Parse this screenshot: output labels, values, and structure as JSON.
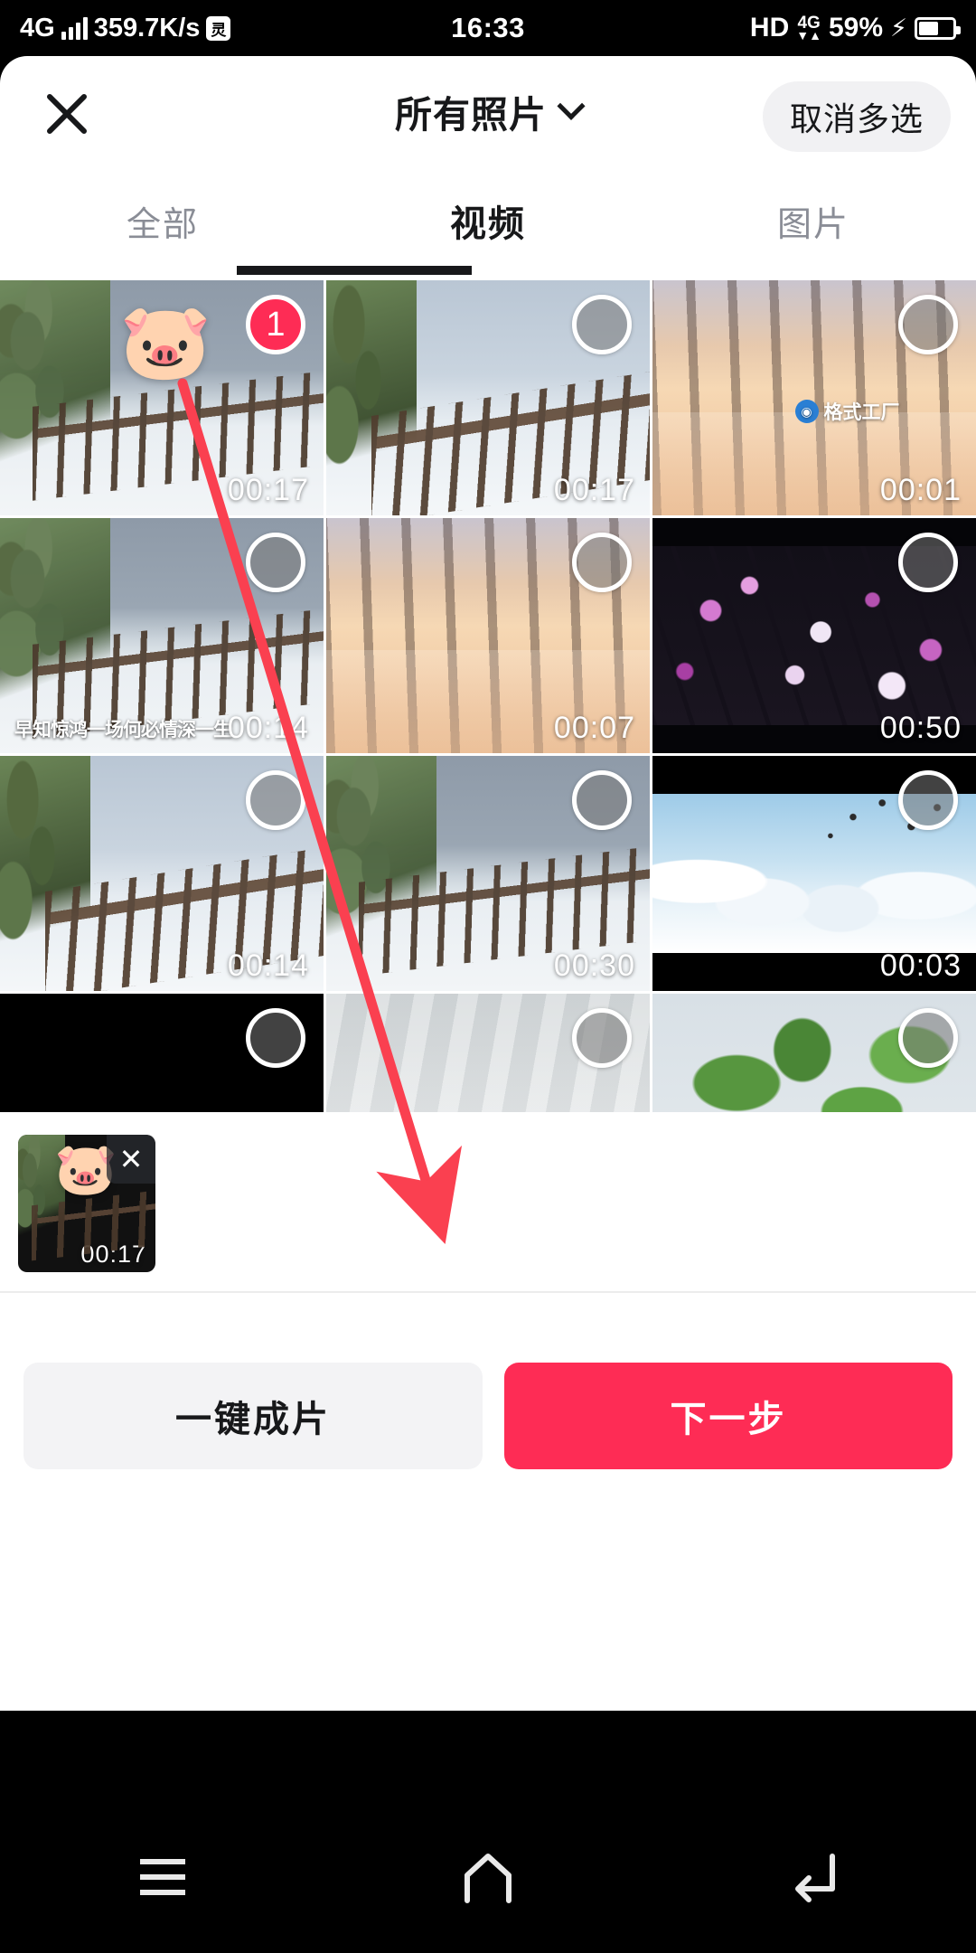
{
  "status_bar": {
    "network_type": "4G",
    "speed": "359.7K/s",
    "app_icon": "灵",
    "time": "16:33",
    "hd": "HD",
    "volte": "4G",
    "battery_percent": "59%",
    "charging_icon": "charging-bolt"
  },
  "header": {
    "close_icon": "close-icon",
    "title": "所有照片",
    "dropdown_icon": "chevron-down-icon",
    "cancel_multiselect_label": "取消多选"
  },
  "tabs": [
    {
      "label": "全部",
      "active": false
    },
    {
      "label": "视频",
      "active": true
    },
    {
      "label": "图片",
      "active": false
    }
  ],
  "grid": {
    "items": [
      {
        "duration": "00:17",
        "selected": true,
        "badge": "1",
        "sticker": "🐷",
        "scene": "sc-snowfence",
        "caption": ""
      },
      {
        "duration": "00:17",
        "selected": false,
        "badge": "",
        "sticker": "",
        "scene": "sc-snowfence2",
        "caption": ""
      },
      {
        "duration": "00:01",
        "selected": false,
        "badge": "",
        "sticker": "",
        "scene": "sc-sunset",
        "caption": "",
        "watermark": "格式工厂"
      },
      {
        "duration": "00:14",
        "selected": false,
        "badge": "",
        "sticker": "",
        "scene": "sc-snowfence",
        "caption": "早知惊鸿一场何必情深一生"
      },
      {
        "duration": "00:07",
        "selected": false,
        "badge": "",
        "sticker": "",
        "scene": "sc-sunset",
        "caption": ""
      },
      {
        "duration": "00:50",
        "selected": false,
        "badge": "",
        "sticker": "",
        "scene": "sc-blossom",
        "caption": ""
      },
      {
        "duration": "00:14",
        "selected": false,
        "badge": "",
        "sticker": "",
        "scene": "sc-snowfence2",
        "caption": ""
      },
      {
        "duration": "00:30",
        "selected": false,
        "badge": "",
        "sticker": "",
        "scene": "sc-snowfence",
        "caption": ""
      },
      {
        "duration": "00:03",
        "selected": false,
        "badge": "",
        "sticker": "",
        "scene": "sc-winterbirds",
        "caption": ""
      },
      {
        "duration": "",
        "selected": false,
        "badge": "",
        "sticker": "",
        "scene": "sc-darkstrip",
        "caption": ""
      },
      {
        "duration": "",
        "selected": false,
        "badge": "",
        "sticker": "",
        "scene": "sc-fog",
        "caption": ""
      },
      {
        "duration": "",
        "selected": false,
        "badge": "",
        "sticker": "",
        "scene": "sc-greensnow",
        "caption": ""
      }
    ]
  },
  "selected_tray": {
    "items": [
      {
        "duration": "00:17",
        "sticker": "🐷",
        "remove_icon": "✕"
      }
    ]
  },
  "action_bar": {
    "secondary_label": "一键成片",
    "primary_label": "下一步"
  },
  "nav_bar": {
    "recents_icon": "menu-icon",
    "home_icon": "home-icon",
    "back_icon": "back-icon"
  },
  "annotation": {
    "arrow_color": "#fa4050",
    "from": "selected-grid-cell",
    "to": "next-step-button"
  },
  "colors": {
    "accent_red": "#fe2c55",
    "annotation_red": "#fa4050",
    "sheet_bg": "#ffffff",
    "pill_bg": "#f1f1f3",
    "secondary_btn_bg": "#f3f3f5",
    "text_primary": "#17181a",
    "text_muted": "#8a8d96"
  }
}
